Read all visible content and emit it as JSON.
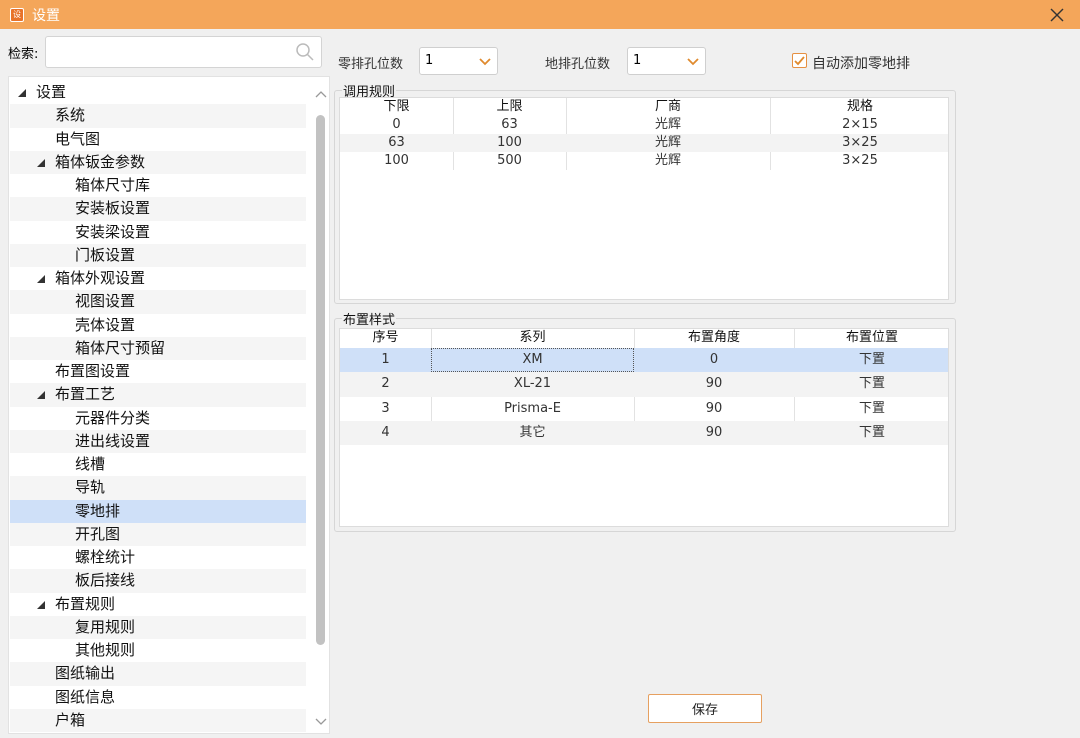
{
  "window": {
    "icon_glyph": "设",
    "title": "设置",
    "close_icon": "close-icon"
  },
  "search": {
    "label": "检索:",
    "value": "",
    "placeholder": "",
    "icon": "search-icon"
  },
  "tree": {
    "items": [
      {
        "label": "设置",
        "level": 0,
        "expander": "expanded"
      },
      {
        "label": "系统",
        "level": 1
      },
      {
        "label": "电气图",
        "level": 1
      },
      {
        "label": "箱体钣金参数",
        "level": 1,
        "expander": "expanded"
      },
      {
        "label": "箱体尺寸库",
        "level": 2
      },
      {
        "label": "安装板设置",
        "level": 2
      },
      {
        "label": "安装梁设置",
        "level": 2
      },
      {
        "label": "门板设置",
        "level": 2
      },
      {
        "label": "箱体外观设置",
        "level": 1,
        "expander": "expanded"
      },
      {
        "label": "视图设置",
        "level": 2
      },
      {
        "label": "壳体设置",
        "level": 2
      },
      {
        "label": "箱体尺寸预留",
        "level": 2
      },
      {
        "label": "布置图设置",
        "level": 1
      },
      {
        "label": "布置工艺",
        "level": 1,
        "expander": "expanded"
      },
      {
        "label": "元器件分类",
        "level": 2
      },
      {
        "label": "进出线设置",
        "level": 2
      },
      {
        "label": "线槽",
        "level": 2
      },
      {
        "label": "导轨",
        "level": 2
      },
      {
        "label": "零地排",
        "level": 2,
        "selected": true
      },
      {
        "label": "开孔图",
        "level": 2
      },
      {
        "label": "螺栓统计",
        "level": 2
      },
      {
        "label": "板后接线",
        "level": 2
      },
      {
        "label": "布置规则",
        "level": 1,
        "expander": "expanded"
      },
      {
        "label": "复用规则",
        "level": 2
      },
      {
        "label": "其他规则",
        "level": 2
      },
      {
        "label": "图纸输出",
        "level": 1
      },
      {
        "label": "图纸信息",
        "level": 1
      },
      {
        "label": "户箱",
        "level": 1
      }
    ]
  },
  "controls": {
    "zero_bar_holes_label": "零排孔位数",
    "zero_bar_holes_value": "1",
    "ground_bar_holes_label": "地排孔位数",
    "ground_bar_holes_value": "1",
    "auto_add_checked": true,
    "auto_add_label": "自动添加零地排"
  },
  "rules_table": {
    "title": "调用规则",
    "columns": [
      "下限",
      "上限",
      "厂商",
      "规格"
    ],
    "rows": [
      [
        "0",
        "63",
        "光辉",
        "2×15"
      ],
      [
        "63",
        "100",
        "光辉",
        "3×25"
      ],
      [
        "100",
        "500",
        "光辉",
        "3×25"
      ]
    ]
  },
  "layout_table": {
    "title": "布置样式",
    "columns": [
      "序号",
      "系列",
      "布置角度",
      "布置位置"
    ],
    "rows": [
      [
        "1",
        "XM",
        "0",
        "下置"
      ],
      [
        "2",
        "XL-21",
        "90",
        "下置"
      ],
      [
        "3",
        "Prisma-E",
        "90",
        "下置"
      ],
      [
        "4",
        "其它",
        "90",
        "下置"
      ]
    ],
    "selected_row": 0
  },
  "footer": {
    "save_label": "保存"
  },
  "colors": {
    "titlebar": "#f4a65a",
    "accent": "#e69042",
    "selection": "#cfe0f8"
  }
}
